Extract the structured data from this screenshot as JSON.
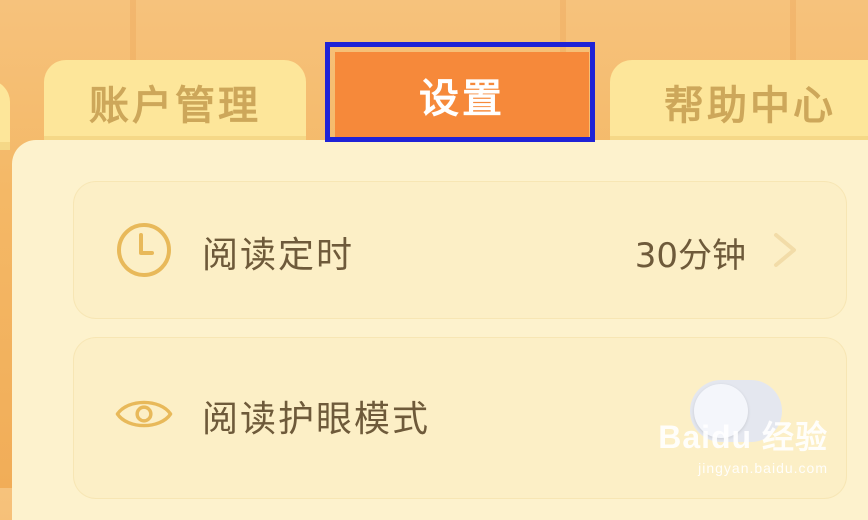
{
  "tabs": {
    "account_label": "账户管理",
    "settings_label": "设置",
    "help_label": "帮助中心"
  },
  "settings": {
    "timer": {
      "icon": "clock-icon",
      "label": "阅读定时",
      "value": "30分钟"
    },
    "eye_mode": {
      "icon": "eye-icon",
      "label": "阅读护眼模式",
      "enabled": false
    }
  },
  "watermark": {
    "main": "Baidu 经验",
    "sub": "jingyan.baidu.com"
  },
  "colors": {
    "active_tab": "#f6893a",
    "inactive_tab": "#fde69a",
    "highlight_border": "#1f22d6",
    "panel": "#fdf2cd",
    "text": "#6e5a3a",
    "icon": "#e8b95a"
  }
}
